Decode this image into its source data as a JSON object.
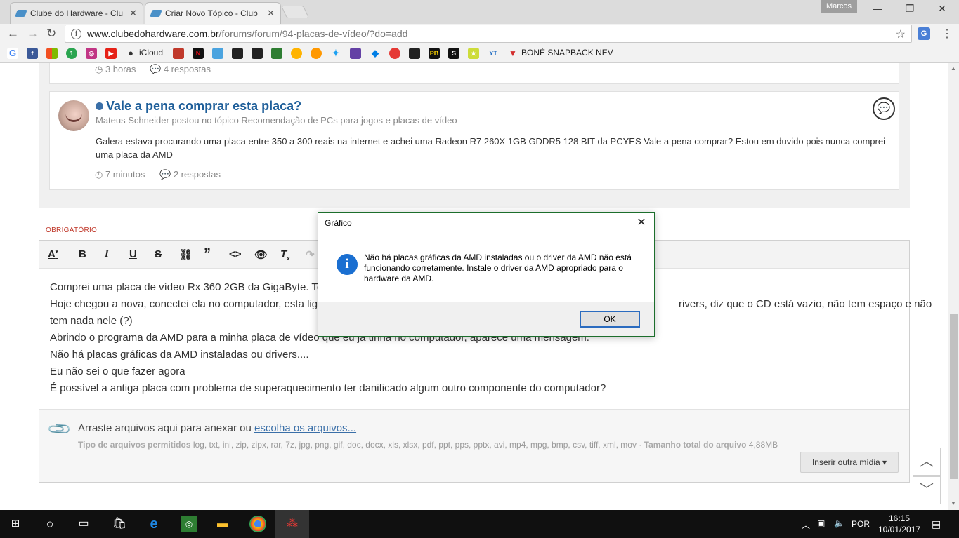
{
  "browser": {
    "tabs": [
      {
        "title": "Clube do Hardware - Clu",
        "active": false
      },
      {
        "title": "Criar Novo Tópico - Club",
        "active": true
      }
    ],
    "user": "Marcos",
    "url_host": "www.clubedohardware.com.br",
    "url_path": "/forums/forum/94-placas-de-vídeo/?do=add",
    "bookmark_labels": {
      "icloud": "iCloud",
      "bone": "BONÉ SNAPBACK NEV"
    }
  },
  "feed": {
    "prev_item": {
      "time": "3 horas",
      "replies": "4 respostas"
    },
    "item": {
      "title": "Vale a pena comprar esta placa?",
      "subtitle": "Mateus Schneider postou no tópico Recomendação de PCs para jogos e placas de vídeo",
      "body": "Galera estava procurando uma placa entre 350 a 300 reais na internet e achei uma Radeon R7 260X 1GB GDDR5 128 BIT da PCYES Vale a pena comprar? Estou em duvido pois nunca comprei uma placa da AMD",
      "time": "7 minutos",
      "replies": "2 respostas"
    }
  },
  "form": {
    "required_label": "OBRIGATÓRIO",
    "editor_lines": [
      "Comprei uma placa de vídeo Rx 360 2GB da GigaByte. Te",
      "Hoje chegou a nova, conectei ela no computador, esta liga",
      "tem nada nele (?)",
      "Abrindo o programa da AMD para a minha placa de vídeo que eu já tinha no computador, aparece uma mensagem.",
      "Não há placas gráficas da AMD instaladas ou drivers....",
      "Eu não sei o que fazer agora",
      "É possível a antiga placa com problema de superaquecimento ter danificado algum outro componente do computador?"
    ],
    "editor_line2_tail": "rivers, diz que o CD está vazio, não tem espaço e não",
    "attach_text": "Arraste arquivos aqui para anexar ou",
    "attach_link": "escolha os arquivos...",
    "attach_types_label": "Tipo de arquivos permitidos",
    "attach_types": "log, txt, ini, zip, zipx, rar, 7z, jpg, png, gif, doc, docx, xls, xlsx, pdf, ppt, pps, pptx, avi, mp4, mpg, bmp, csv, tiff, xml, mov",
    "attach_size_label": "Tamanho total do arquivo",
    "attach_size": "4,88MB",
    "insert_button": "Inserir outra mídia ▾"
  },
  "dialog": {
    "title": "Gráfico",
    "message": "Não há placas gráficas da AMD instaladas ou o driver da AMD não está funcionando corretamente. Instale o driver da AMD apropriado para o hardware da AMD.",
    "ok": "OK"
  },
  "taskbar": {
    "language": "POR",
    "time": "16:15",
    "date": "10/01/2017"
  }
}
